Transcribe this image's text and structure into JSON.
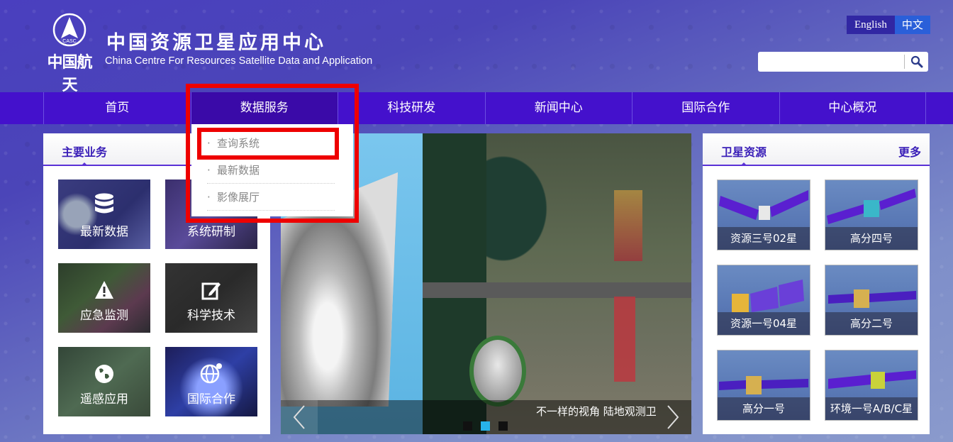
{
  "header": {
    "emblem_text": "CASC",
    "brand_cn": "中国航天",
    "title_cn": "中国资源卫星应用中心",
    "title_en": "China Centre For Resources Satellite Data and Application",
    "lang": {
      "english": "English",
      "chinese": "中文",
      "active": "chinese"
    },
    "search": {
      "placeholder": "",
      "value": ""
    }
  },
  "nav": {
    "items": [
      "首页",
      "数据服务",
      "科技研发",
      "新闻中心",
      "国际合作",
      "中心概况"
    ],
    "active": "数据服务"
  },
  "dropdown": {
    "bullet": "·",
    "items": [
      "查询系统",
      "最新数据",
      "影像展厅"
    ],
    "highlighted": "查询系统"
  },
  "main_business": {
    "title": "主要业务",
    "tiles": [
      {
        "label": "最新数据",
        "icon": "database-icon"
      },
      {
        "label": "系统研制",
        "icon": "system-icon"
      },
      {
        "label": "应急监测",
        "icon": "warning-icon"
      },
      {
        "label": "科学技术",
        "icon": "edit-icon"
      },
      {
        "label": "遥感应用",
        "icon": "globe-icon"
      },
      {
        "label": "国际合作",
        "icon": "network-globe-icon"
      }
    ]
  },
  "slider": {
    "caption": "不一样的视角 陆地观测卫",
    "total_slides": 3,
    "active_slide": 2
  },
  "satellites": {
    "title": "卫星资源",
    "more": "更多",
    "items": [
      "资源三号02星",
      "高分四号",
      "资源一号04星",
      "高分二号",
      "高分一号",
      "环境一号A/B/C星"
    ]
  },
  "colors": {
    "nav_bg": "#4411cc",
    "accent": "#3a1fb8",
    "highlight_box": "#ee0000",
    "dot_active": "#27b3ea"
  }
}
